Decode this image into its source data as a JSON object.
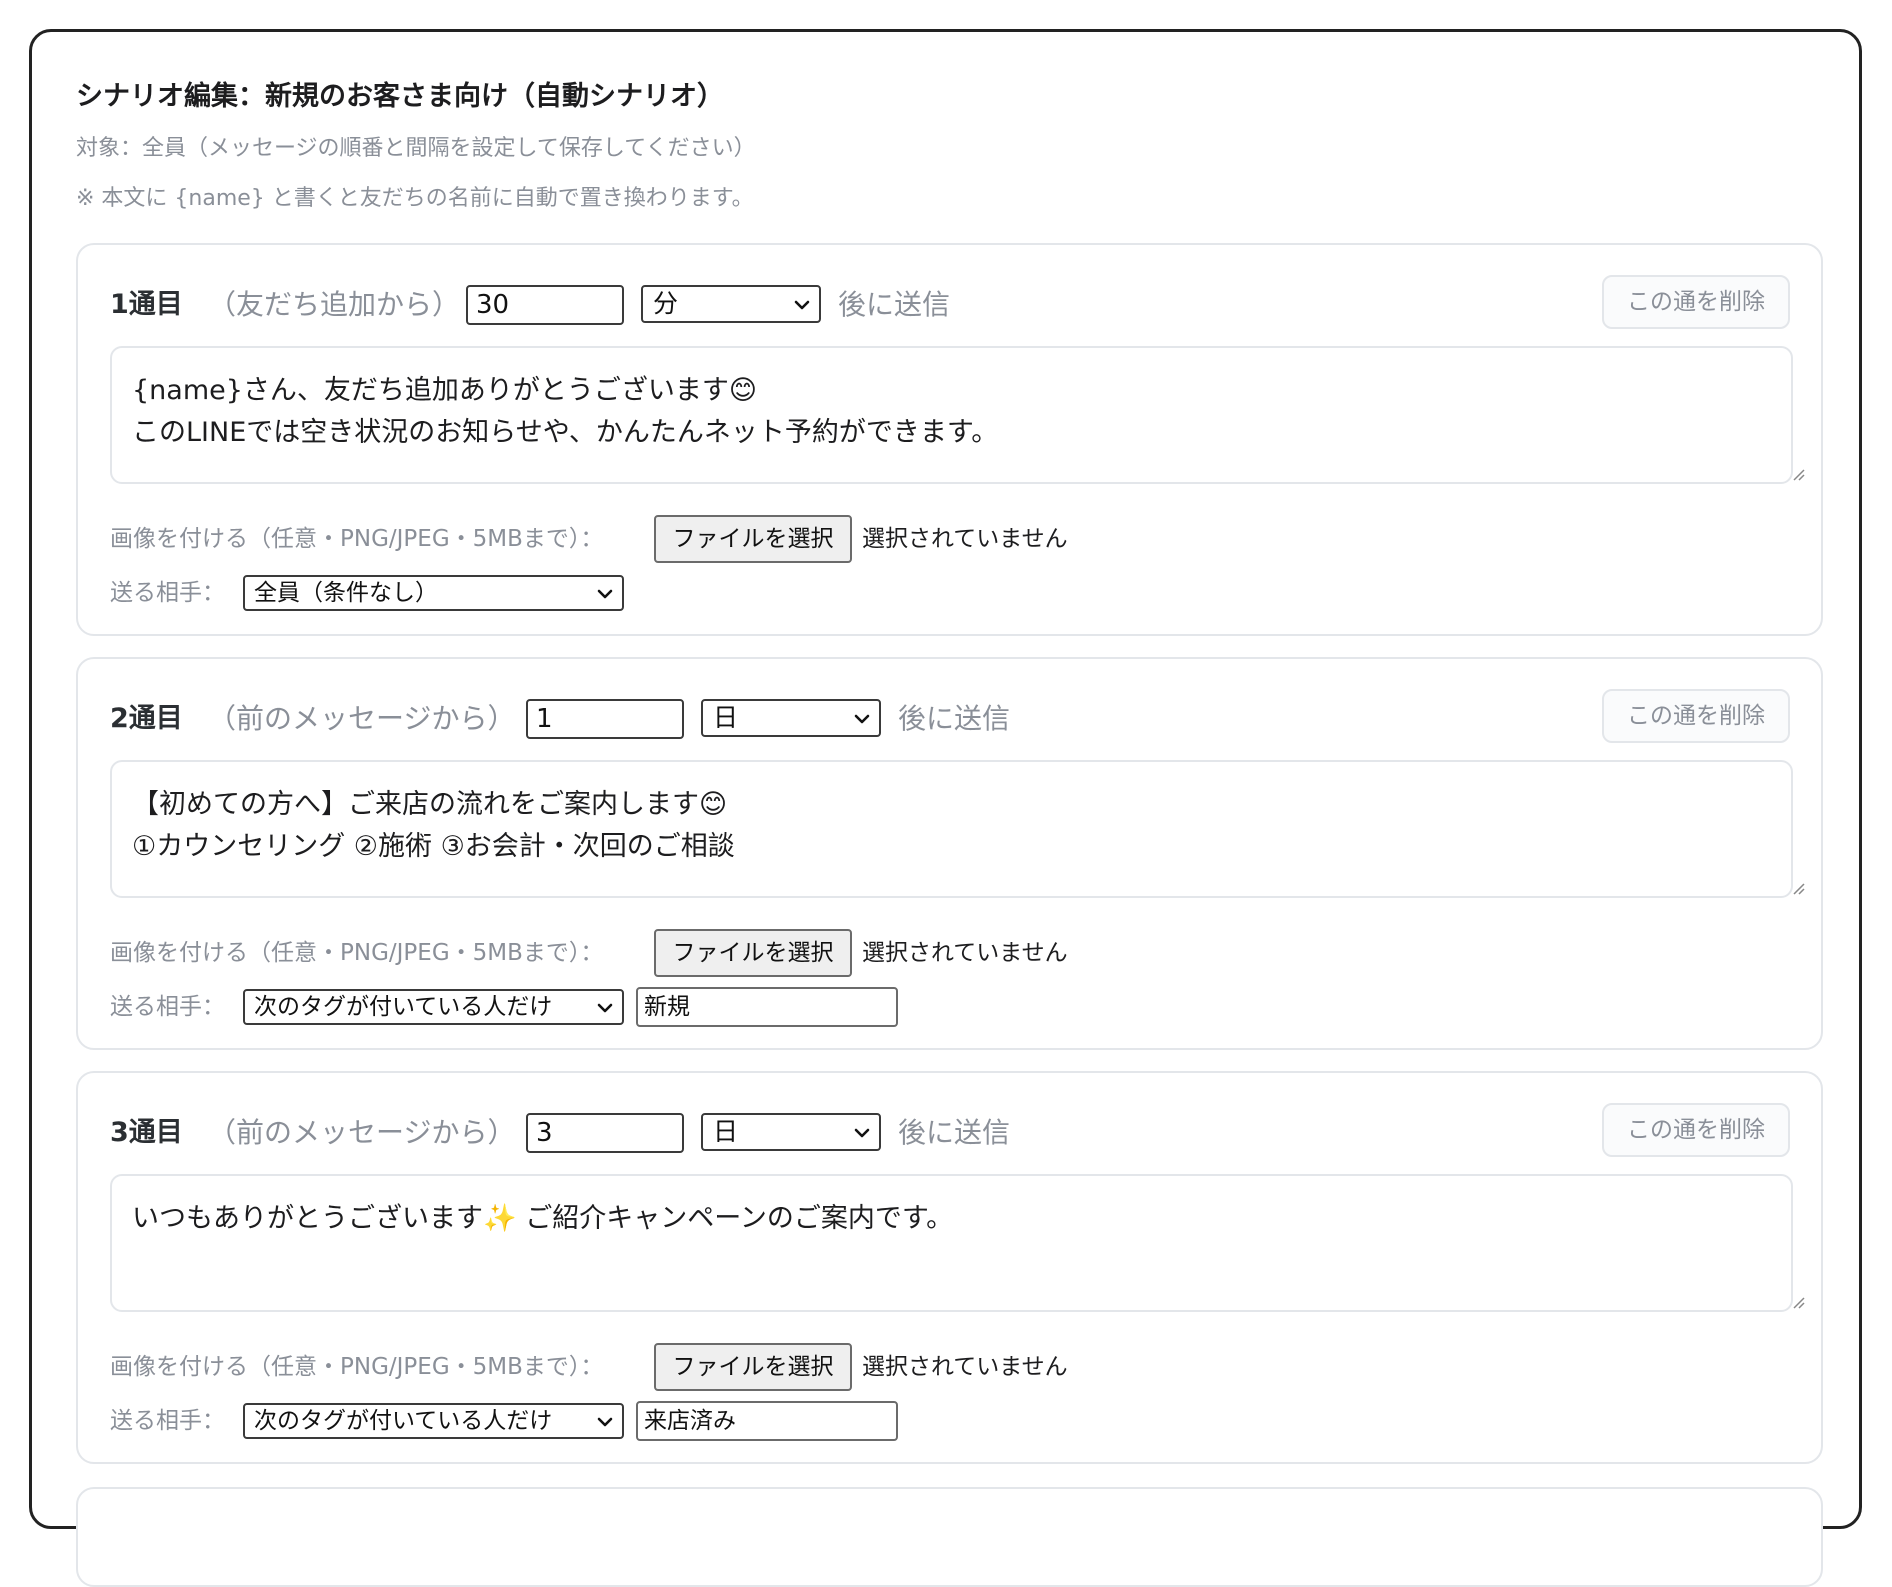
{
  "page": {
    "title": "シナリオ編集：新規のお客さま向け（自動シナリオ）",
    "subtitle": "対象：全員（メッセージの順番と間隔を設定して保存してください）",
    "note": "※ 本文に {name} と書くと友だちの名前に自動で置き換わります。"
  },
  "common": {
    "after_label": "後に送信",
    "delete_label": "この通を削除",
    "image_label": "画像を付ける（任意・PNG/JPEG・5MBまで）：",
    "file_button": "ファイルを選択",
    "file_status": "選択されていません",
    "to_label": "送る相手："
  },
  "messages": [
    {
      "number": "1通目",
      "hint": "（友だち追加から）",
      "delay": "30",
      "unit": "分",
      "body": "{name}さん、友だち追加ありがとうございます😊\nこのLINEでは空き状況のお知らせや、かんたんネット予約ができます。",
      "audience": "全員（条件なし）",
      "tag": ""
    },
    {
      "number": "2通目",
      "hint": "（前のメッセージから）",
      "delay": "1",
      "unit": "日",
      "body": "【初めての方へ】ご来店の流れをご案内します😊\n①カウンセリング ②施術 ③お会計・次回のご相談",
      "audience": "次のタグが付いている人だけ",
      "tag": "新規"
    },
    {
      "number": "3通目",
      "hint": "（前のメッセージから）",
      "delay": "3",
      "unit": "日",
      "body": "いつもありがとうございます✨ ご紹介キャンペーンのご案内です。",
      "audience": "次のタグが付いている人だけ",
      "tag": "来店済み"
    }
  ],
  "icons": {
    "chevron": "chevron-down-icon",
    "resize": "resize-handle-icon"
  },
  "colors": {
    "muted_text": "#8a8f98",
    "card_border": "#e3e6ea",
    "panel_border": "#222222"
  }
}
